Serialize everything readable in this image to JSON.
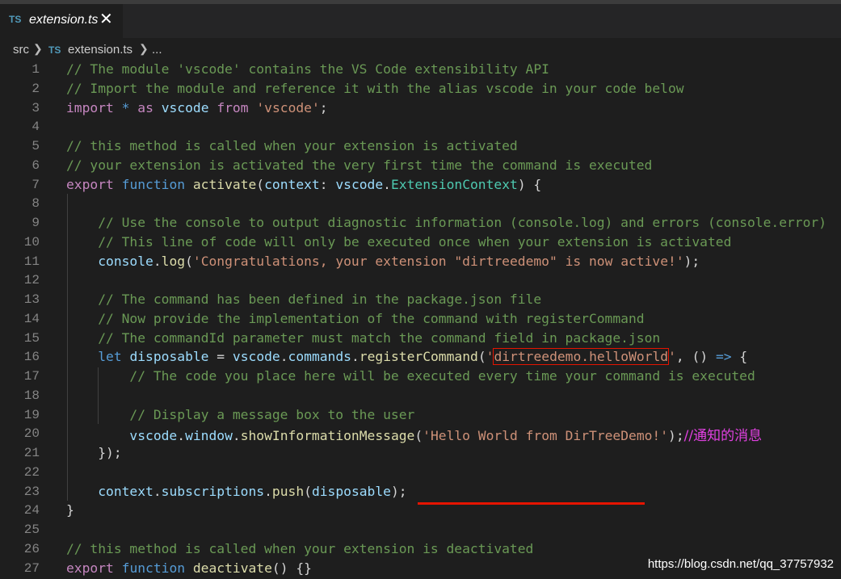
{
  "tab": {
    "ts_badge": "TS",
    "title": "extension.ts",
    "close_glyph": "✕"
  },
  "breadcrumb": {
    "folder": "src",
    "ts_badge": "TS",
    "file": "extension.ts",
    "more": "..."
  },
  "lines": [
    {
      "n": "1",
      "tokens": [
        [
          "c",
          "// The module 'vscode' contains the VS Code extensibility API"
        ]
      ]
    },
    {
      "n": "2",
      "tokens": [
        [
          "c",
          "// Import the module and reference it with the alias vscode in your code below"
        ]
      ]
    },
    {
      "n": "3",
      "tokens": [
        [
          "kc",
          "import"
        ],
        [
          "p",
          " "
        ],
        [
          "k",
          "*"
        ],
        [
          "p",
          " "
        ],
        [
          "kc",
          "as"
        ],
        [
          "p",
          " "
        ],
        [
          "v",
          "vscode"
        ],
        [
          "p",
          " "
        ],
        [
          "kc",
          "from"
        ],
        [
          "p",
          " "
        ],
        [
          "s",
          "'vscode'"
        ],
        [
          "p",
          ";"
        ]
      ]
    },
    {
      "n": "4",
      "tokens": []
    },
    {
      "n": "5",
      "tokens": [
        [
          "c",
          "// this method is called when your extension is activated"
        ]
      ]
    },
    {
      "n": "6",
      "tokens": [
        [
          "c",
          "// your extension is activated the very first time the command is executed"
        ]
      ]
    },
    {
      "n": "7",
      "tokens": [
        [
          "kc",
          "export"
        ],
        [
          "p",
          " "
        ],
        [
          "k",
          "function"
        ],
        [
          "p",
          " "
        ],
        [
          "f",
          "activate"
        ],
        [
          "p",
          "("
        ],
        [
          "v",
          "context"
        ],
        [
          "p",
          ": "
        ],
        [
          "v",
          "vscode"
        ],
        [
          "p",
          "."
        ],
        [
          "t",
          "ExtensionContext"
        ],
        [
          "p",
          ") {"
        ]
      ]
    },
    {
      "n": "8",
      "tokens": []
    },
    {
      "n": "9",
      "tokens": [
        [
          "p",
          "    "
        ],
        [
          "c",
          "// Use the console to output diagnostic information (console.log) and errors (console.error)"
        ]
      ]
    },
    {
      "n": "10",
      "tokens": [
        [
          "p",
          "    "
        ],
        [
          "c",
          "// This line of code will only be executed once when your extension is activated"
        ]
      ]
    },
    {
      "n": "11",
      "tokens": [
        [
          "p",
          "    "
        ],
        [
          "v",
          "console"
        ],
        [
          "p",
          "."
        ],
        [
          "f",
          "log"
        ],
        [
          "p",
          "("
        ],
        [
          "s",
          "'Congratulations, your extension \"dirtreedemo\" is now active!'"
        ],
        [
          "p",
          ");"
        ]
      ]
    },
    {
      "n": "12",
      "tokens": []
    },
    {
      "n": "13",
      "tokens": [
        [
          "p",
          "    "
        ],
        [
          "c",
          "// The command has been defined in the package.json file"
        ]
      ]
    },
    {
      "n": "14",
      "tokens": [
        [
          "p",
          "    "
        ],
        [
          "c",
          "// Now provide the implementation of the command with registerCommand"
        ]
      ]
    },
    {
      "n": "15",
      "tokens": [
        [
          "p",
          "    "
        ],
        [
          "c",
          "// The commandId parameter must match the command field in package.json"
        ]
      ]
    },
    {
      "n": "16",
      "tokens": [
        [
          "p",
          "    "
        ],
        [
          "k",
          "let"
        ],
        [
          "p",
          " "
        ],
        [
          "v",
          "disposable"
        ],
        [
          "p",
          " = "
        ],
        [
          "v",
          "vscode"
        ],
        [
          "p",
          "."
        ],
        [
          "v",
          "commands"
        ],
        [
          "p",
          "."
        ],
        [
          "f",
          "registerCommand"
        ],
        [
          "p",
          "("
        ],
        [
          "s",
          "'"
        ],
        [
          "s hl-box",
          "dirtreedemo.helloWorld"
        ],
        [
          "s",
          "'"
        ],
        [
          "p",
          ", () "
        ],
        [
          "k",
          "=>"
        ],
        [
          "p",
          " {"
        ]
      ]
    },
    {
      "n": "17",
      "tokens": [
        [
          "p",
          "        "
        ],
        [
          "c",
          "// The code you place here will be executed every time your command is executed"
        ]
      ]
    },
    {
      "n": "18",
      "tokens": []
    },
    {
      "n": "19",
      "tokens": [
        [
          "p",
          "        "
        ],
        [
          "c",
          "// Display a message box to the user"
        ]
      ]
    },
    {
      "n": "20",
      "tokens": [
        [
          "p",
          "        "
        ],
        [
          "v",
          "vscode"
        ],
        [
          "p",
          "."
        ],
        [
          "v",
          "window"
        ],
        [
          "p",
          "."
        ],
        [
          "f",
          "showInformationMessage"
        ],
        [
          "p",
          "("
        ],
        [
          "s",
          "'Hello World from DirTreeDemo!'"
        ],
        [
          "p",
          ");"
        ],
        [
          "note",
          "//通知的消息"
        ]
      ]
    },
    {
      "n": "21",
      "tokens": [
        [
          "p",
          "    });"
        ]
      ]
    },
    {
      "n": "22",
      "tokens": []
    },
    {
      "n": "23",
      "tokens": [
        [
          "p",
          "    "
        ],
        [
          "v",
          "context"
        ],
        [
          "p",
          "."
        ],
        [
          "v",
          "subscriptions"
        ],
        [
          "p",
          "."
        ],
        [
          "f",
          "push"
        ],
        [
          "p",
          "("
        ],
        [
          "v",
          "disposable"
        ],
        [
          "p",
          ");"
        ]
      ]
    },
    {
      "n": "24",
      "tokens": [
        [
          "p",
          "}"
        ]
      ]
    },
    {
      "n": "25",
      "tokens": []
    },
    {
      "n": "26",
      "tokens": [
        [
          "c",
          "// this method is called when your extension is deactivated"
        ]
      ]
    },
    {
      "n": "27",
      "tokens": [
        [
          "kc",
          "export"
        ],
        [
          "p",
          " "
        ],
        [
          "k",
          "function"
        ],
        [
          "p",
          " "
        ],
        [
          "f",
          "deactivate"
        ],
        [
          "p",
          "() {}"
        ]
      ]
    }
  ],
  "watermark": "https://blog.csdn.net/qq_37757932",
  "colors": {
    "background": "#1e1e1e",
    "comment": "#6a9955",
    "keyword": "#569cd6",
    "control": "#c586c0",
    "variable": "#9cdcfe",
    "string": "#ce9178",
    "function": "#dcdcaa",
    "type": "#4ec9b0",
    "annotation": "#e51400",
    "note": "#e040e0"
  }
}
